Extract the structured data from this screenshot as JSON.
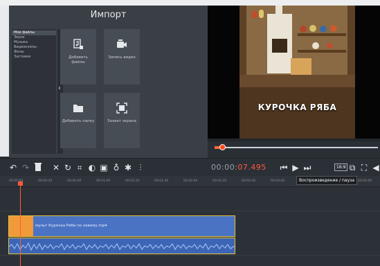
{
  "import_panel": {
    "title": "Импорт",
    "categories": [
      "Мои файлы",
      "Звуки",
      "Музыка",
      "Видеоклипы",
      "Фоны",
      "Заставки"
    ],
    "active_category": 0,
    "collapse_icon": "chevron-left-icon",
    "tiles": [
      {
        "label": "Добавить файлы",
        "icon": "add-files-icon"
      },
      {
        "label": "Запись видео",
        "icon": "video-camera-icon"
      },
      {
        "label": "Добавить папку",
        "icon": "folder-icon"
      },
      {
        "label": "Захват экрана",
        "icon": "screen-capture-icon"
      }
    ]
  },
  "preview": {
    "video_title": "КУРОЧКА РЯБА",
    "progress": 0.03
  },
  "toolbar": {
    "tools": [
      "undo-icon",
      "redo-icon",
      "delete-icon",
      "cut-icon",
      "rotate-icon",
      "crop-icon",
      "color-icon",
      "image-icon",
      "audio-icon",
      "settings-icon",
      "equalizer-icon"
    ],
    "timecode_prefix": "00:00:",
    "timecode_current": "07.495",
    "ratio": "16:9",
    "tooltip": "Воспроизведение / пауза"
  },
  "timeline": {
    "ticks": [
      "00:00:00",
      "00:00:20",
      "00:00:40",
      "00:01:00",
      "00:01:20",
      "00:01:40",
      "00:02:00",
      "00:02:20",
      "00:02:40",
      "00:03:00",
      "00:03:20",
      "00:03:40",
      "00:04:00"
    ],
    "clip_name": "мульт Курочка Ряба по новому.mp4"
  },
  "colors": {
    "accent": "#ff5a3a",
    "clip": "#4a73c4",
    "clip_border": "#e3c23f"
  }
}
